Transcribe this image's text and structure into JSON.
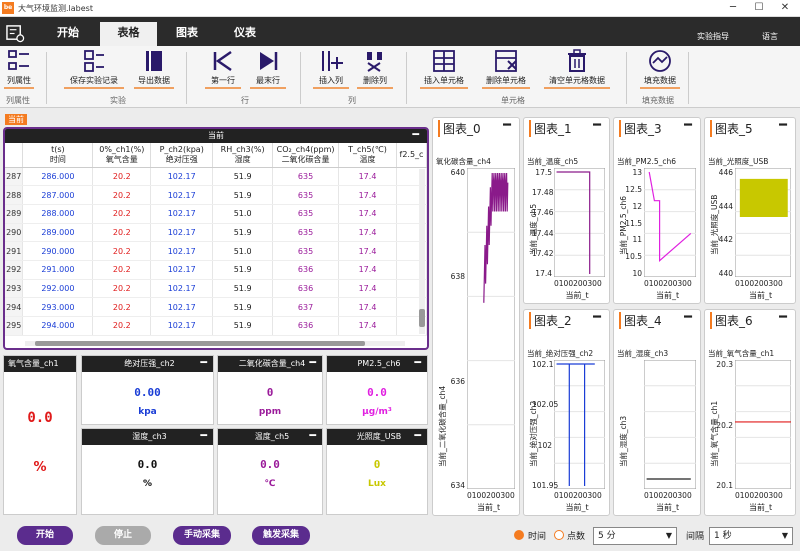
{
  "window": {
    "title": "大气环境监测.labest",
    "app_icon": "be"
  },
  "menu": {
    "tabs": [
      "开始",
      "表格",
      "图表",
      "仪表"
    ],
    "active": 1,
    "right": [
      "实验指导",
      "语言"
    ]
  },
  "ribbon": {
    "buttons": [
      "列属性",
      "保存实验记录",
      "导出数据",
      "第一行",
      "最末行",
      "插入列",
      "删除列",
      "插入单元格",
      "删除单元格",
      "清空单元格数据",
      "填充数据"
    ],
    "groups": [
      "列属性",
      "实验",
      "行",
      "列",
      "单元格",
      "填充数据"
    ]
  },
  "current_tab_label": "当前",
  "table": {
    "title": "当前",
    "headers": [
      [
        "t(s)",
        "时间"
      ],
      [
        "0%_ch1(%)",
        "氧气含量"
      ],
      [
        "P_ch2(kpa)",
        "绝对压强"
      ],
      [
        "RH_ch3(%)",
        "湿度"
      ],
      [
        "CO₂_ch4(ppm)",
        "二氧化碳含量"
      ],
      [
        "T_ch5(℃)",
        "温度"
      ],
      [
        "f2.5_c",
        ""
      ]
    ],
    "rows": [
      [
        "287",
        "286.000",
        "20.2",
        "102.17",
        "51.9",
        "635",
        "17.4"
      ],
      [
        "288",
        "287.000",
        "20.2",
        "102.17",
        "51.9",
        "635",
        "17.4"
      ],
      [
        "289",
        "288.000",
        "20.2",
        "102.17",
        "51.0",
        "635",
        "17.4"
      ],
      [
        "290",
        "289.000",
        "20.2",
        "102.17",
        "51.9",
        "635",
        "17.4"
      ],
      [
        "291",
        "290.000",
        "20.2",
        "102.17",
        "51.0",
        "635",
        "17.4"
      ],
      [
        "292",
        "291.000",
        "20.2",
        "102.17",
        "51.9",
        "636",
        "17.4"
      ],
      [
        "293",
        "292.000",
        "20.2",
        "102.17",
        "51.9",
        "636",
        "17.4"
      ],
      [
        "294",
        "293.000",
        "20.2",
        "102.17",
        "51.9",
        "637",
        "17.4"
      ],
      [
        "295",
        "294.000",
        "20.2",
        "102.17",
        "51.9",
        "636",
        "17.4"
      ]
    ]
  },
  "gauges": [
    {
      "name": "氧气含量_ch1",
      "value": "0.0",
      "unit": "%",
      "color": "#e01a1a"
    },
    {
      "name": "绝对压强_ch2",
      "value": "0.00",
      "unit": "kpa",
      "color": "#1a3dd6"
    },
    {
      "name": "二氧化碳含量_ch4",
      "value": "0",
      "unit": "ppm",
      "color": "#9a1a9a"
    },
    {
      "name": "PM2.5_ch6",
      "value": "0.0",
      "unit": "μg/m³",
      "color": "#e020e0"
    },
    {
      "name": "湿度_ch3",
      "value": "0.0",
      "unit": "%",
      "color": "#111111"
    },
    {
      "name": "温度_ch5",
      "value": "0.0",
      "unit": "℃",
      "color": "#9a1a9a"
    },
    {
      "name": "光照度_USB",
      "value": "0",
      "unit": "Lux",
      "color": "#c8c800"
    }
  ],
  "charts": [
    {
      "title": "图表_0",
      "series": "氧化碳含量_ch4",
      "ylabel": "当前_二氧化碳含量_ch4",
      "xlabel": "当前_t",
      "yticks": [
        "640",
        "638",
        "636",
        "634"
      ],
      "color": "#8a1a8a"
    },
    {
      "title": "图表_1",
      "series": "当前_温度_ch5",
      "ylabel": "当前_温度_ch5",
      "xlabel": "当前_t",
      "yticks": [
        "17.5",
        "17.48",
        "17.46",
        "17.44",
        "17.42",
        "17.4"
      ],
      "color": "#8a1a8a"
    },
    {
      "title": "图表_3",
      "series": "当前_PM2.5_ch6",
      "ylabel": "当前_PM2.5_ch6",
      "xlabel": "当前_t",
      "yticks": [
        "13",
        "12.5",
        "12",
        "11.5",
        "11",
        "10.5",
        "10"
      ],
      "color": "#e020e0"
    },
    {
      "title": "图表_5",
      "series": "当前_光照度_USB",
      "ylabel": "当前_光照度_USB",
      "xlabel": "当前_t",
      "yticks": [
        "446",
        "444",
        "442",
        "440"
      ],
      "color": "#c8c800"
    },
    {
      "title": "图表_2",
      "series": "当前_绝对压强_ch2",
      "ylabel": "当前_绝对压强_ch2",
      "xlabel": "当前_t",
      "yticks": [
        "102.1",
        "102.05",
        "102",
        "101.95"
      ],
      "color": "#1a3dd6"
    },
    {
      "title": "图表_4",
      "series": "当前_湿度_ch3",
      "ylabel": "当前_湿度_ch3",
      "xlabel": "当前_t",
      "yticks": [],
      "color": "#222222"
    },
    {
      "title": "图表_6",
      "series": "当前_氧气含量_ch1",
      "ylabel": "当前_氧气含量_ch1",
      "xlabel": "当前_t",
      "yticks": [
        "20.3",
        "20.2",
        "20.1"
      ],
      "color": "#e01a1a"
    }
  ],
  "xtick": "0100200300",
  "bottom": {
    "start": "开始",
    "stop": "停止",
    "manual": "手动采集",
    "trigger": "触发采集",
    "mode_time": "时间",
    "mode_points": "点数",
    "duration": "5 分",
    "interval_label": "间隔",
    "interval": "1 秒"
  }
}
